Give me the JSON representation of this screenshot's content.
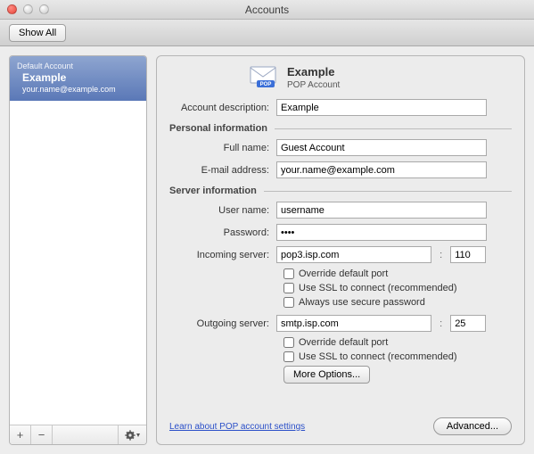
{
  "window": {
    "title": "Accounts",
    "show_all": "Show All"
  },
  "sidebar": {
    "default_label": "Default Account",
    "account_name": "Example",
    "account_email": "your.name@example.com",
    "add": "+",
    "remove": "−"
  },
  "header": {
    "title": "Example",
    "subtitle": "POP Account"
  },
  "labels": {
    "description": "Account description:",
    "personal": "Personal information",
    "fullname": "Full name:",
    "email": "E-mail address:",
    "server": "Server information",
    "username": "User name:",
    "password": "Password:",
    "incoming": "Incoming server:",
    "outgoing": "Outgoing server:",
    "override": "Override default port",
    "ssl": "Use SSL to connect (recommended)",
    "securepwd": "Always use secure password",
    "more": "More Options...",
    "learn": "Learn about POP account settings",
    "advanced": "Advanced..."
  },
  "values": {
    "description": "Example",
    "fullname": "Guest Account",
    "email": "your.name@example.com",
    "username": "username",
    "password": "••••",
    "incoming": "pop3.isp.com",
    "incoming_port": "110",
    "outgoing": "smtp.isp.com",
    "outgoing_port": "25",
    "portsep": ":"
  }
}
